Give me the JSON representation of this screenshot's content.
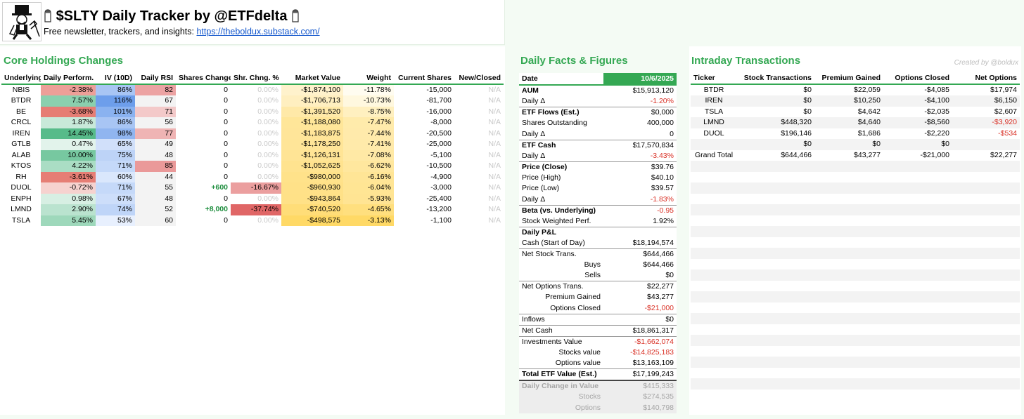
{
  "header": {
    "title": "$SLTY Daily Tracker by @ETFdelta",
    "subtitle": "Free newsletter, trackers, and insights: ",
    "link": "https://theboldux.substack.com/"
  },
  "core": {
    "title": "Core Holdings Changes",
    "columns": [
      "Underlying",
      "Daily Perform.",
      "IV (10D)",
      "Daily RSI",
      "Shares Change",
      "Shr. Chng. %",
      "Market Value",
      "Weight",
      "Current Shares",
      "New/Closed"
    ],
    "rows": [
      {
        "t": "NBIS",
        "p": "-2.38%",
        "iv": "86%",
        "rsi": "82",
        "sc": "0",
        "scp": "0.00%",
        "mv": "-$1,874,100",
        "w": "-11.78%",
        "cs": "-15,000",
        "nc": "N/A"
      },
      {
        "t": "BTDR",
        "p": "7.57%",
        "iv": "116%",
        "rsi": "67",
        "sc": "0",
        "scp": "0.00%",
        "mv": "-$1,706,713",
        "w": "-10.73%",
        "cs": "-81,700",
        "nc": "N/A"
      },
      {
        "t": "BE",
        "p": "-3.68%",
        "iv": "101%",
        "rsi": "71",
        "sc": "0",
        "scp": "0.00%",
        "mv": "-$1,391,520",
        "w": "-8.75%",
        "cs": "-16,000",
        "nc": "N/A"
      },
      {
        "t": "CRCL",
        "p": "1.87%",
        "iv": "86%",
        "rsi": "56",
        "sc": "0",
        "scp": "0.00%",
        "mv": "-$1,188,080",
        "w": "-7.47%",
        "cs": "-8,000",
        "nc": "N/A"
      },
      {
        "t": "IREN",
        "p": "14.45%",
        "iv": "98%",
        "rsi": "77",
        "sc": "0",
        "scp": "0.00%",
        "mv": "-$1,183,875",
        "w": "-7.44%",
        "cs": "-20,500",
        "nc": "N/A"
      },
      {
        "t": "GTLB",
        "p": "0.47%",
        "iv": "65%",
        "rsi": "49",
        "sc": "0",
        "scp": "0.00%",
        "mv": "-$1,178,250",
        "w": "-7.41%",
        "cs": "-25,000",
        "nc": "N/A"
      },
      {
        "t": "ALAB",
        "p": "10.00%",
        "iv": "75%",
        "rsi": "48",
        "sc": "0",
        "scp": "0.00%",
        "mv": "-$1,126,131",
        "w": "-7.08%",
        "cs": "-5,100",
        "nc": "N/A"
      },
      {
        "t": "KTOS",
        "p": "4.22%",
        "iv": "71%",
        "rsi": "85",
        "sc": "0",
        "scp": "0.00%",
        "mv": "-$1,052,625",
        "w": "-6.62%",
        "cs": "-10,500",
        "nc": "N/A"
      },
      {
        "t": "RH",
        "p": "-3.61%",
        "iv": "60%",
        "rsi": "44",
        "sc": "0",
        "scp": "0.00%",
        "mv": "-$980,000",
        "w": "-6.16%",
        "cs": "-4,900",
        "nc": "N/A"
      },
      {
        "t": "DUOL",
        "p": "-0.72%",
        "iv": "71%",
        "rsi": "55",
        "sc": "+600",
        "scp": "-16.67%",
        "mv": "-$960,930",
        "w": "-6.04%",
        "cs": "-3,000",
        "nc": "N/A"
      },
      {
        "t": "ENPH",
        "p": "0.98%",
        "iv": "67%",
        "rsi": "48",
        "sc": "0",
        "scp": "0.00%",
        "mv": "-$943,864",
        "w": "-5.93%",
        "cs": "-25,400",
        "nc": "N/A"
      },
      {
        "t": "LMND",
        "p": "2.90%",
        "iv": "74%",
        "rsi": "52",
        "sc": "+8,000",
        "scp": "-37.74%",
        "mv": "-$740,520",
        "w": "-4.65%",
        "cs": "-13,200",
        "nc": "N/A"
      },
      {
        "t": "TSLA",
        "p": "5.45%",
        "iv": "53%",
        "rsi": "60",
        "sc": "0",
        "scp": "0.00%",
        "mv": "-$498,575",
        "w": "-3.13%",
        "cs": "-1,100",
        "nc": "N/A"
      }
    ]
  },
  "daily": {
    "title": "Daily Facts & Figures",
    "date_label": "Date",
    "date": "10/6/2025",
    "rows": [
      {
        "l": "AUM",
        "v": "$15,913,120",
        "b": true,
        "sep": true
      },
      {
        "l": "Daily Δ",
        "v": "-1.20%",
        "red": true
      },
      {
        "l": "ETF Flows (Est.)",
        "v": "$0,000",
        "b": true,
        "sep": true
      },
      {
        "l": "Shares Outstanding",
        "v": "400,000"
      },
      {
        "l": "Daily Δ",
        "v": "0"
      },
      {
        "l": "ETF Cash",
        "v": "$17,570,834",
        "b": true,
        "sep": true
      },
      {
        "l": "Daily Δ",
        "v": "-3.43%",
        "red": true
      },
      {
        "l": "Price (Close)",
        "v": "$39.76",
        "b": true,
        "sep": true
      },
      {
        "l": "Price (High)",
        "v": "$40.10"
      },
      {
        "l": "Price (Low)",
        "v": "$39.57"
      },
      {
        "l": "Daily Δ",
        "v": "-1.83%",
        "red": true
      },
      {
        "l": "Beta (vs. Underlying)",
        "v": "-0.95",
        "b": true,
        "red": true,
        "sep": true
      },
      {
        "l": "Stock Weighted Perf.",
        "v": "1.92%"
      },
      {
        "l": "Daily P&L",
        "v": "",
        "b": true,
        "sep": true
      },
      {
        "l": "Cash (Start of Day)",
        "v": "$18,194,574"
      },
      {
        "l": "Net Stock Trans.",
        "v": "$644,466",
        "sep": true
      },
      {
        "l": "Buys",
        "v": "$644,466",
        "ind": true
      },
      {
        "l": "Sells",
        "v": "$0",
        "ind": true
      },
      {
        "l": "Net Options Trans.",
        "v": "$22,277",
        "sep": true
      },
      {
        "l": "Premium Gained",
        "v": "$43,277",
        "ind": true
      },
      {
        "l": "Options Closed",
        "v": "-$21,000",
        "ind": true,
        "red": true
      },
      {
        "l": "Inflows",
        "v": "$0",
        "sep": true
      },
      {
        "l": "Net Cash",
        "v": "$18,861,317",
        "sep": true
      },
      {
        "l": "Investments Value",
        "v": "-$1,662,074",
        "red": true,
        "sep": true
      },
      {
        "l": "Stocks value",
        "v": "-$14,825,183",
        "ind": true,
        "red": true
      },
      {
        "l": "Options value",
        "v": "$13,163,109",
        "ind": true
      },
      {
        "l": "Total ETF Value (Est.)",
        "v": "$17,199,243",
        "b": true,
        "sep": true
      },
      {
        "l": "Daily Change in Value",
        "v": "$415,333",
        "b": true,
        "gs": true,
        "dbl": true
      },
      {
        "l": "Stocks",
        "v": "$274,535",
        "ind": true,
        "gs": true
      },
      {
        "l": "Options",
        "v": "$140,798",
        "ind": true,
        "gs": true
      }
    ]
  },
  "intraday": {
    "title": "Intraday Transactions",
    "credit": "Created by @boldux",
    "columns": [
      "Ticker",
      "Stock Transactions",
      "Premium Gained",
      "Options Closed",
      "Net Options"
    ],
    "rows": [
      {
        "t": "BTDR",
        "s": "$0",
        "pg": "$22,059",
        "oc": "-$4,085",
        "no": "$17,974"
      },
      {
        "t": "IREN",
        "s": "$0",
        "pg": "$10,250",
        "oc": "-$4,100",
        "no": "$6,150"
      },
      {
        "t": "TSLA",
        "s": "$0",
        "pg": "$4,642",
        "oc": "-$2,035",
        "no": "$2,607"
      },
      {
        "t": "LMND",
        "s": "$448,320",
        "pg": "$4,640",
        "oc": "-$8,560",
        "no": "-$3,920",
        "neg": true
      },
      {
        "t": "DUOL",
        "s": "$196,146",
        "pg": "$1,686",
        "oc": "-$2,220",
        "no": "-$534",
        "neg": true
      },
      {
        "t": "",
        "s": "$0",
        "pg": "$0",
        "oc": "$0",
        "no": ""
      },
      {
        "t": "Grand Total",
        "s": "$644,466",
        "pg": "$43,277",
        "oc": "-$21,000",
        "no": "$22,277"
      }
    ]
  },
  "colors": {
    "accent": "#34a853",
    "negative": "#d93025",
    "link": "#1155cc"
  }
}
